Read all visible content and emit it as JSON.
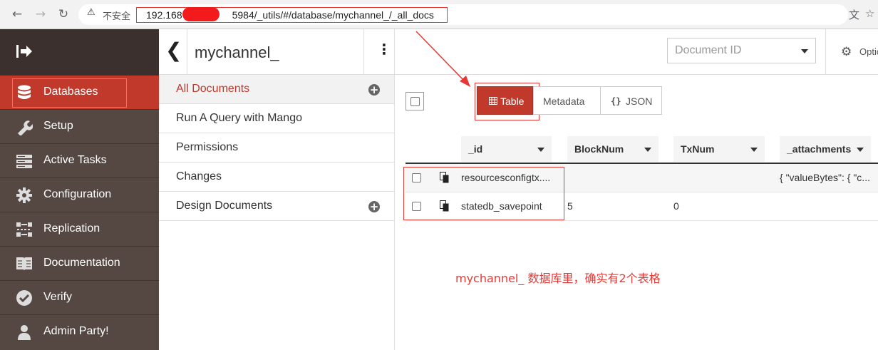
{
  "browser": {
    "back_icon": "arrow-left",
    "forward_icon": "arrow-right",
    "reload_icon": "reload",
    "warning_icon": "warning-triangle",
    "insecure_label": "不安全",
    "url_prefix": "192.168",
    "url_suffix": "5984/_utils/#/database/mychannel_/_all_docs",
    "translate_icon": "translate",
    "bookmark_icon": "star"
  },
  "sidebar": {
    "logo_icon": "logout-arrow",
    "items": [
      {
        "label": "Databases",
        "icon": "database-icon",
        "active": true
      },
      {
        "label": "Setup",
        "icon": "wrench-icon"
      },
      {
        "label": "Active Tasks",
        "icon": "tasks-icon"
      },
      {
        "label": "Configuration",
        "icon": "gear-icon"
      },
      {
        "label": "Replication",
        "icon": "replication-icon"
      },
      {
        "label": "Documentation",
        "icon": "book-icon"
      },
      {
        "label": "Verify",
        "icon": "check-circle-icon"
      },
      {
        "label": "Admin Party!",
        "icon": "user-icon"
      }
    ]
  },
  "database": {
    "title": "mychannel_",
    "menu": [
      {
        "label": "All Documents",
        "selected": true,
        "has_add": true
      },
      {
        "label": "Run A Query with Mango"
      },
      {
        "label": "Permissions"
      },
      {
        "label": "Changes"
      },
      {
        "label": "Design Documents",
        "has_add": true
      }
    ]
  },
  "header": {
    "doc_id_placeholder": "Document ID",
    "options_label": "Optio"
  },
  "views": {
    "table": "Table",
    "metadata": "Metadata",
    "json": "JSON",
    "active": "table"
  },
  "table": {
    "columns": [
      "_id",
      "BlockNum",
      "TxNum",
      "_attachments"
    ],
    "rows": [
      {
        "id": "resourcesconfigtx....",
        "block": "",
        "tx": "",
        "attachments": "{ \"valueBytes\": { \"c..."
      },
      {
        "id": "statedb_savepoint",
        "block": "5",
        "tx": "0",
        "attachments": ""
      }
    ]
  },
  "annotation": "mychannel_ 数据库里，确实有2个表格",
  "colors": {
    "accent": "#c0392b",
    "sidebar_bg": "#554843",
    "annotation_red": "#e53935"
  }
}
